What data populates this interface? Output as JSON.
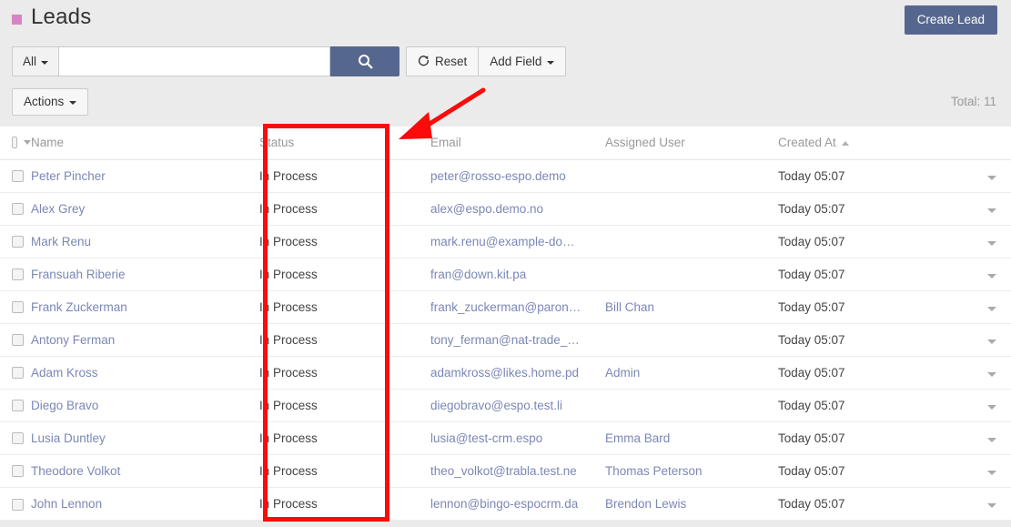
{
  "header": {
    "title": "Leads",
    "square_color": "#d884c4",
    "create_button": "Create Lead"
  },
  "search": {
    "scope_label": "All",
    "input_value": "",
    "input_placeholder": "",
    "search_icon": "search-icon",
    "reset_label": "Reset",
    "reset_icon": "refresh-icon",
    "add_field_label": "Add Field"
  },
  "toolbar": {
    "actions_label": "Actions",
    "total_label": "Total: 11"
  },
  "table": {
    "columns": [
      {
        "key": "checkbox",
        "label": ""
      },
      {
        "key": "name",
        "label": "Name"
      },
      {
        "key": "status",
        "label": "Status"
      },
      {
        "key": "email",
        "label": "Email"
      },
      {
        "key": "assignedUser",
        "label": "Assigned User"
      },
      {
        "key": "createdAt",
        "label": "Created At",
        "sorted": "asc"
      },
      {
        "key": "menu",
        "label": ""
      }
    ],
    "rows": [
      {
        "name": "Peter Pincher",
        "status": "In Process",
        "email": "peter@rosso-espo.demo",
        "assignedUser": "",
        "createdAt": "Today 05:07"
      },
      {
        "name": "Alex Grey",
        "status": "In Process",
        "email": "alex@espo.demo.no",
        "assignedUser": "",
        "createdAt": "Today 05:07"
      },
      {
        "name": "Mark Renu",
        "status": "In Process",
        "email": "mark.renu@example-do…",
        "assignedUser": "",
        "createdAt": "Today 05:07"
      },
      {
        "name": "Fransuah Riberie",
        "status": "In Process",
        "email": "fran@down.kit.pa",
        "assignedUser": "",
        "createdAt": "Today 05:07"
      },
      {
        "name": "Frank Zuckerman",
        "status": "In Process",
        "email": "frank_zuckerman@paron…",
        "assignedUser": "Bill Chan",
        "createdAt": "Today 05:07"
      },
      {
        "name": "Antony Ferman",
        "status": "In Process",
        "email": "tony_ferman@nat-trade_…",
        "assignedUser": "",
        "createdAt": "Today 05:07"
      },
      {
        "name": "Adam Kross",
        "status": "In Process",
        "email": "adamkross@likes.home.pd",
        "assignedUser": "Admin",
        "createdAt": "Today 05:07"
      },
      {
        "name": "Diego Bravo",
        "status": "In Process",
        "email": "diegobravo@espo.test.li",
        "assignedUser": "",
        "createdAt": "Today 05:07"
      },
      {
        "name": "Lusia Duntley",
        "status": "In Process",
        "email": "lusia@test-crm.espo",
        "assignedUser": "Emma Bard",
        "createdAt": "Today 05:07"
      },
      {
        "name": "Theodore Volkot",
        "status": "In Process",
        "email": "theo_volkot@trabla.test.ne",
        "assignedUser": "Thomas Peterson",
        "createdAt": "Today 05:07"
      },
      {
        "name": "John Lennon",
        "status": "In Process",
        "email": "lennon@bingo-espocrm.da",
        "assignedUser": "Brendon Lewis",
        "createdAt": "Today 05:07"
      }
    ]
  },
  "annotations": {
    "color": "#fb0b09",
    "highlight_target": "Status",
    "arrow_points_to": "Status"
  },
  "colors": {
    "accent": "#56678f",
    "link": "#7b87b5",
    "page_background": "#ebebeb",
    "table_background": "#ffffff",
    "annotation": "#fb0b09",
    "title_square": "#d884c4"
  }
}
